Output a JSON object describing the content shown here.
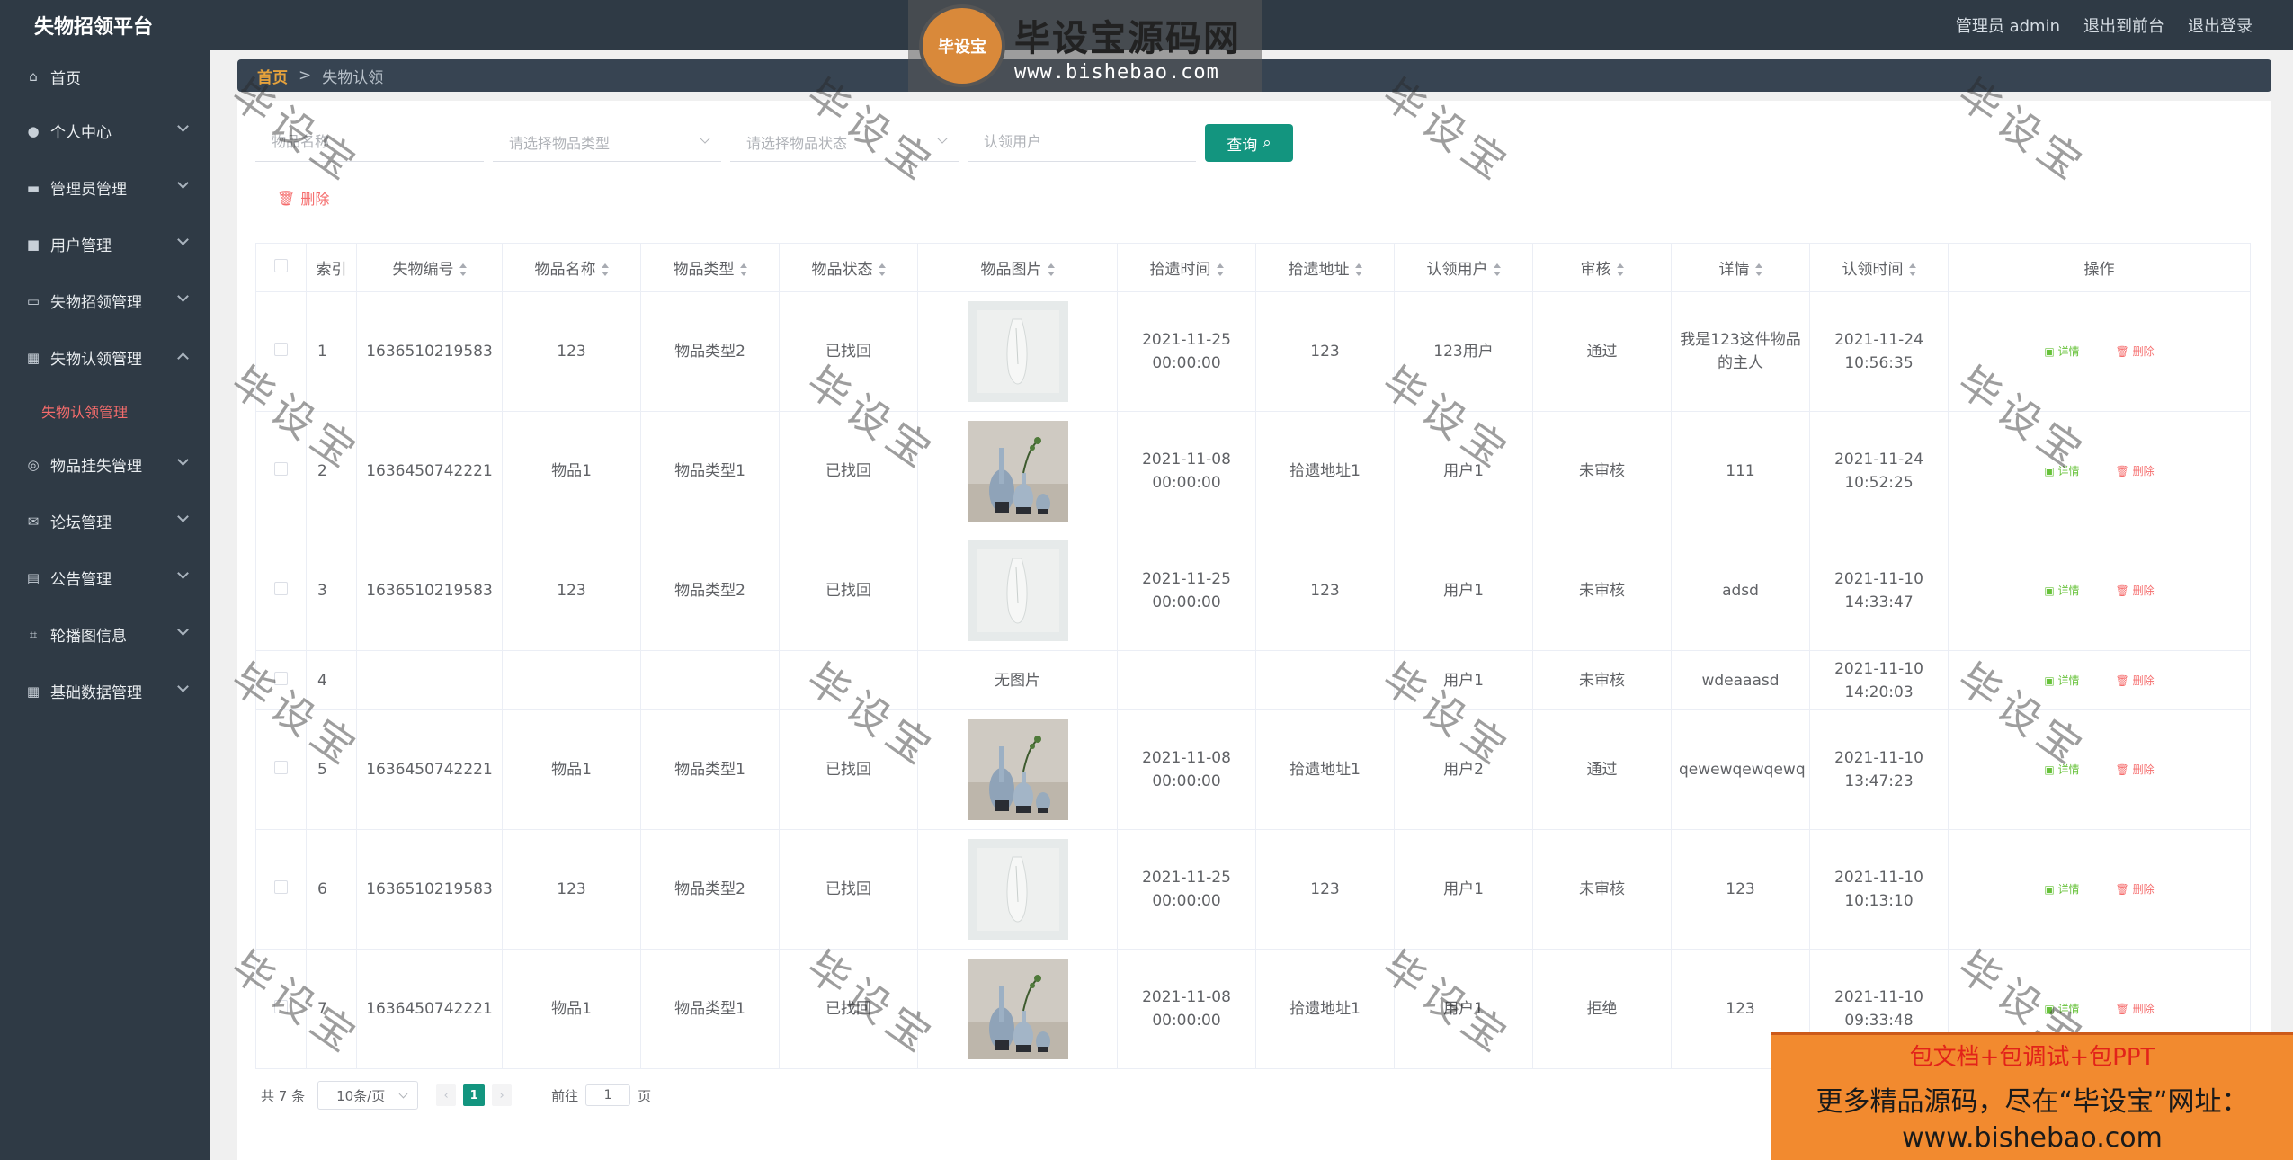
{
  "app": {
    "title": "失物招领平台"
  },
  "topbar": {
    "admin": "管理员 admin",
    "to_front": "退出到前台",
    "logout": "退出登录"
  },
  "sidebar": {
    "items": [
      {
        "label": "首页",
        "icon": "home-icon"
      },
      {
        "label": "个人中心",
        "icon": "user-icon"
      },
      {
        "label": "管理员管理",
        "icon": "chat-icon"
      },
      {
        "label": "用户管理",
        "icon": "briefcase-icon"
      },
      {
        "label": "失物招领管理",
        "icon": "card-icon"
      },
      {
        "label": "失物认领管理",
        "icon": "grid-icon"
      },
      {
        "label": "物品挂失管理",
        "icon": "compass-icon"
      },
      {
        "label": "论坛管理",
        "icon": "mail-icon"
      },
      {
        "label": "公告管理",
        "icon": "clipboard-icon"
      },
      {
        "label": "轮播图信息",
        "icon": "crop-icon"
      },
      {
        "label": "基础数据管理",
        "icon": "apps-icon"
      }
    ],
    "sub_active": "失物认领管理"
  },
  "breadcrumb": {
    "home": "首页",
    "sep": ">",
    "current": "失物认领"
  },
  "filters": {
    "name_placeholder": "物品名称",
    "type_placeholder": "请选择物品类型",
    "status_placeholder": "请选择物品状态",
    "user_placeholder": "认领用户",
    "query_label": "查询",
    "delete_label": "删除"
  },
  "table": {
    "headers": [
      "索引",
      "失物编号",
      "物品名称",
      "物品类型",
      "物品状态",
      "物品图片",
      "拾遗时间",
      "拾遗地址",
      "认领用户",
      "审核",
      "详情",
      "认领时间",
      "操作"
    ],
    "rows": [
      {
        "idx": "1",
        "code": "1636510219583",
        "name": "123",
        "type": "物品类型2",
        "status": "已找回",
        "img": "white",
        "pick_time": "2021-11-25 00:00:00",
        "addr": "123",
        "user": "123用户",
        "audit": "通过",
        "detail": "我是123这件物品的主人",
        "claim_time": "2021-11-24 10:56:35"
      },
      {
        "idx": "2",
        "code": "1636450742221",
        "name": "物品1",
        "type": "物品类型1",
        "status": "已找回",
        "img": "vase",
        "pick_time": "2021-11-08 00:00:00",
        "addr": "拾遗地址1",
        "user": "用户1",
        "audit": "未审核",
        "detail": "111",
        "claim_time": "2021-11-24 10:52:25"
      },
      {
        "idx": "3",
        "code": "1636510219583",
        "name": "123",
        "type": "物品类型2",
        "status": "已找回",
        "img": "white",
        "pick_time": "2021-11-25 00:00:00",
        "addr": "123",
        "user": "用户1",
        "audit": "未审核",
        "detail": "adsd",
        "claim_time": "2021-11-10 14:33:47"
      },
      {
        "idx": "4",
        "code": "",
        "name": "",
        "type": "",
        "status": "",
        "img": "none",
        "img_text": "无图片",
        "pick_time": "",
        "addr": "",
        "user": "用户1",
        "audit": "未审核",
        "detail": "wdeaaasd",
        "claim_time": "2021-11-10 14:20:03"
      },
      {
        "idx": "5",
        "code": "1636450742221",
        "name": "物品1",
        "type": "物品类型1",
        "status": "已找回",
        "img": "vase",
        "pick_time": "2021-11-08 00:00:00",
        "addr": "拾遗地址1",
        "user": "用户2",
        "audit": "通过",
        "detail": "qewewqewqewq",
        "claim_time": "2021-11-10 13:47:23"
      },
      {
        "idx": "6",
        "code": "1636510219583",
        "name": "123",
        "type": "物品类型2",
        "status": "已找回",
        "img": "white",
        "pick_time": "2021-11-25 00:00:00",
        "addr": "123",
        "user": "用户1",
        "audit": "未审核",
        "detail": "123",
        "claim_time": "2021-11-10 10:13:10"
      },
      {
        "idx": "7",
        "code": "1636450742221",
        "name": "物品1",
        "type": "物品类型1",
        "status": "已找回",
        "img": "vase",
        "pick_time": "2021-11-08 00:00:00",
        "addr": "拾遗地址1",
        "user": "用户1",
        "audit": "拒绝",
        "detail": "123",
        "claim_time": "2021-11-10 09:33:48"
      }
    ],
    "op_detail": "详情",
    "op_delete": "删除"
  },
  "pager": {
    "total": "共 7 条",
    "size": "10条/页",
    "page": "1",
    "goto": "前往",
    "goto_value": "1",
    "unit": "页"
  },
  "watermark": {
    "text": "毕设宝",
    "logo_badge": "毕设宝",
    "logo_title": "毕设宝源码网",
    "logo_url": "www.bishebao.com",
    "promo_l1": "包文档+包调试+包PPT",
    "promo_l2": "更多精品源码，尽在“毕设宝”网址：",
    "promo_l3": "www.bishebao.com"
  },
  "colors": {
    "sidebar": "#2f3a45",
    "accent": "#13957f",
    "danger": "#f56c6c",
    "success": "#67c23a",
    "crumb": "#e6a23c"
  }
}
